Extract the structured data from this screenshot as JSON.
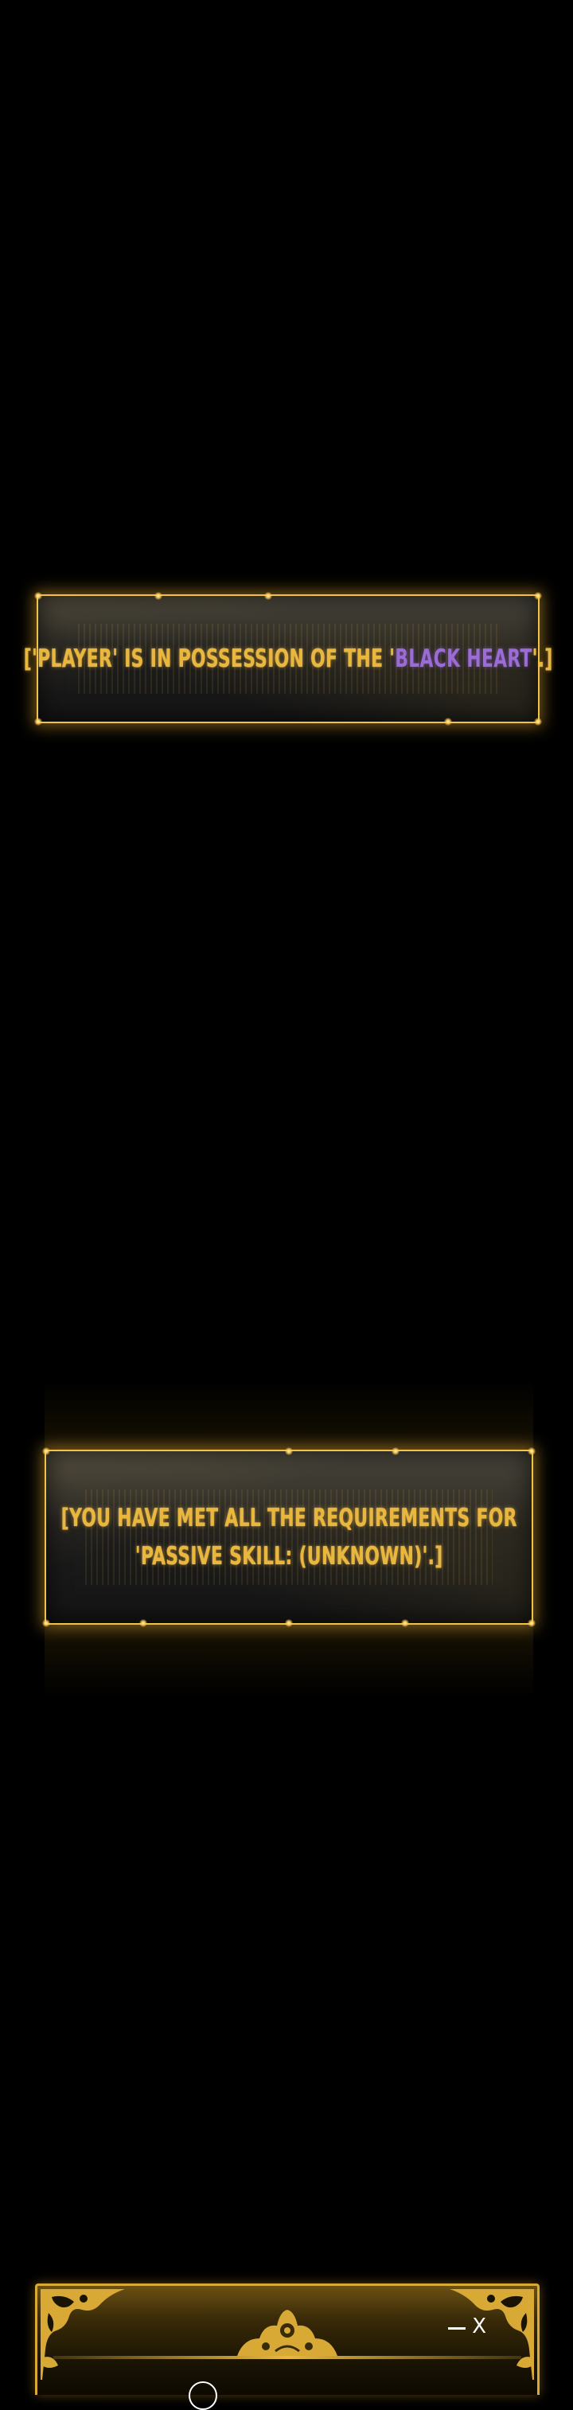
{
  "panels": {
    "possession": {
      "before": "['PLAYER' IS IN POSSESSION OF THE '",
      "highlight": "BLACK HEART",
      "after": "'.]"
    },
    "requirements": {
      "line1": "[YOU HAVE MET ALL THE REQUIREMENTS FOR",
      "line2": "'PASSIVE SKILL: (UNKNOWN)'.]"
    }
  },
  "bottom_window": {
    "close_label": "X"
  },
  "colors": {
    "background": "#000000",
    "panel_border": "#f0c24a",
    "panel_text": "#e9b73d",
    "highlight_text": "#9b6bd6",
    "window_frame": "#d9a936"
  },
  "icons": {
    "minimize": "minimize-icon",
    "close": "close-icon",
    "ornament": "filigree-ornament-icon",
    "crest": "crest-ornament-icon"
  }
}
